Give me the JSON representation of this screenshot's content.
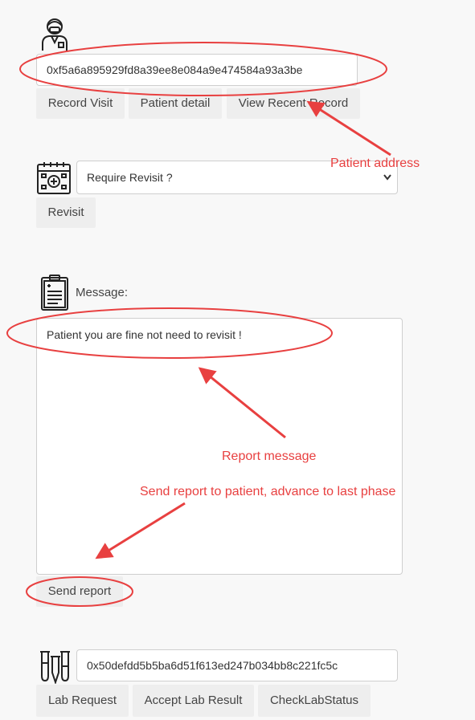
{
  "patient_section": {
    "address_value": "0xf5a6a895929fd8a39ee8e084a9e474584a93a3be",
    "buttons": [
      "Record Visit",
      "Patient detail",
      "View Recent Record"
    ]
  },
  "revisit_section": {
    "select_value": "Require Revisit ?",
    "button": "Revisit"
  },
  "message_section": {
    "label": "Message:",
    "textarea_value": "Patient you are fine not need to revisit !",
    "send_button": "Send report"
  },
  "lab_section": {
    "address_value": "0x50defdd5b5ba6d51f613ed247b034bb8c221fc5c",
    "buttons": [
      "Lab Request",
      "Accept Lab Result",
      "CheckLabStatus"
    ]
  },
  "annotations": {
    "patient_address": "Patient address",
    "report_message": "Report message",
    "send_report_note": "Send report to patient, advance to last phase"
  },
  "colors": {
    "annotation": "#e84040",
    "button_bg": "#eeeeee",
    "page_bg": "#f8f8f8"
  }
}
